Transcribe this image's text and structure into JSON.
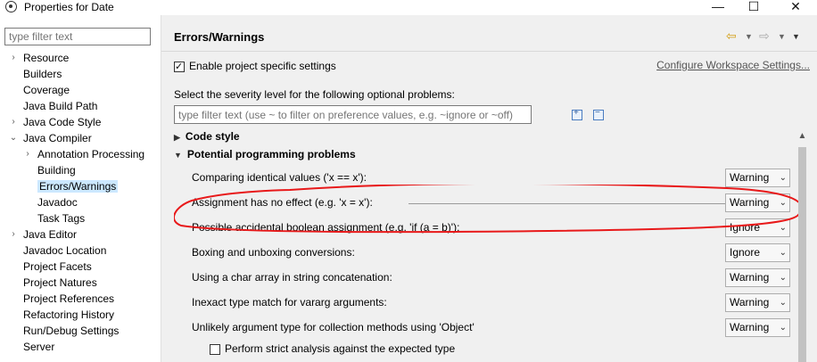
{
  "window": {
    "title": "Properties for Date",
    "minimize_glyph": "—",
    "maximize_glyph": "☐",
    "close_glyph": "✕"
  },
  "left_panel": {
    "filter_placeholder": "type filter text",
    "tree": [
      {
        "label": "Resource",
        "chevron": "›"
      },
      {
        "label": "Builders",
        "chevron": ""
      },
      {
        "label": "Coverage",
        "chevron": ""
      },
      {
        "label": "Java Build Path",
        "chevron": ""
      },
      {
        "label": "Java Code Style",
        "chevron": "›"
      },
      {
        "label": "Java Compiler",
        "chevron": "⌄"
      },
      {
        "label": "Annotation Processing",
        "chevron": "›"
      },
      {
        "label": "Building",
        "chevron": ""
      },
      {
        "label": "Errors/Warnings",
        "chevron": ""
      },
      {
        "label": "Javadoc",
        "chevron": ""
      },
      {
        "label": "Task Tags",
        "chevron": ""
      },
      {
        "label": "Java Editor",
        "chevron": "›"
      },
      {
        "label": "Javadoc Location",
        "chevron": ""
      },
      {
        "label": "Project Facets",
        "chevron": ""
      },
      {
        "label": "Project Natures",
        "chevron": ""
      },
      {
        "label": "Project References",
        "chevron": ""
      },
      {
        "label": "Refactoring History",
        "chevron": ""
      },
      {
        "label": "Run/Debug Settings",
        "chevron": ""
      },
      {
        "label": "Server",
        "chevron": ""
      }
    ],
    "selected_item": "Errors/Warnings"
  },
  "page": {
    "title": "Errors/Warnings",
    "enable_label": "Enable project specific settings",
    "enable_checked": true,
    "configure_link": "Configure Workspace Settings...",
    "severity_label": "Select the severity level for the following optional problems:",
    "pref_filter_placeholder": "type filter text (use ~ to filter on preference values, e.g. ~ignore or ~off)",
    "expand_glyph": "+",
    "collapse_glyph": "−",
    "sections": [
      {
        "label": "Code style",
        "caret": "▶",
        "expanded": false
      },
      {
        "label": "Potential programming problems",
        "caret": "▼",
        "expanded": true
      }
    ],
    "options": [
      {
        "label": "Comparing identical values ('x == x'):",
        "value": "Warning"
      },
      {
        "label": "Assignment has no effect (e.g. 'x = x'):",
        "value": "Warning"
      },
      {
        "label": "Possible accidental boolean assignment (e.g. 'if (a = b)'):",
        "value": "Ignore"
      },
      {
        "label": "Boxing and unboxing conversions:",
        "value": "Ignore"
      },
      {
        "label": "Using a char array in string concatenation:",
        "value": "Warning"
      },
      {
        "label": "Inexact type match for vararg arguments:",
        "value": "Warning"
      },
      {
        "label": "Unlikely argument type for collection methods using 'Object'",
        "value": "Warning"
      }
    ],
    "strict_label": "Perform strict analysis against the expected type",
    "strict_checked": false
  },
  "colors": {
    "selection": "#cce8ff",
    "annotation": "#e8191a",
    "panel_bg": "#f0f0f0"
  }
}
